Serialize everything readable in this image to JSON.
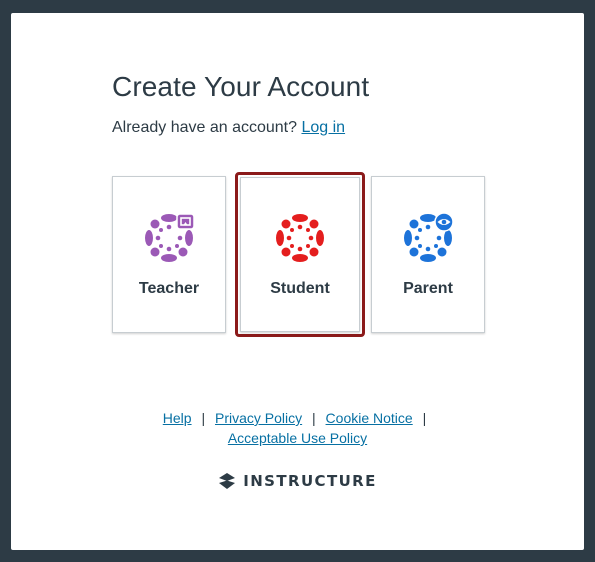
{
  "heading": "Create Your Account",
  "login_prompt": {
    "text": "Already have an account?",
    "link": "Log in"
  },
  "account_types": [
    {
      "label": "Teacher",
      "color": "#9b59b6",
      "icon": "canvas-teacher-icon",
      "selected": false
    },
    {
      "label": "Student",
      "color": "#e41e1e",
      "icon": "canvas-student-icon",
      "selected": true
    },
    {
      "label": "Parent",
      "color": "#1d73d9",
      "icon": "canvas-parent-icon",
      "selected": false
    }
  ],
  "footer": {
    "links": [
      "Help",
      "Privacy Policy",
      "Cookie Notice",
      "Acceptable Use Policy"
    ],
    "separator": "|"
  },
  "brand": {
    "name": "INSTRUCTURE",
    "icon": "instructure-logo-icon"
  },
  "colors": {
    "background": "#2d3b45",
    "link": "#0770a3",
    "selected_border": "#8b1a1a"
  }
}
